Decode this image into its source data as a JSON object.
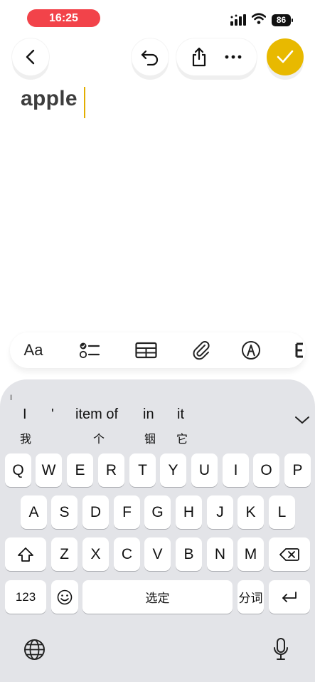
{
  "status_bar": {
    "time": "16:25",
    "battery": "86"
  },
  "note": {
    "text": "apple"
  },
  "format_toolbar": {
    "text_style_label": "Aa"
  },
  "candidates": {
    "small_label": "I",
    "top": [
      "I",
      "'",
      "item of",
      "in",
      "it"
    ],
    "bottom": [
      "我",
      "个",
      "铟",
      "它"
    ]
  },
  "keyboard": {
    "row1": [
      "Q",
      "W",
      "E",
      "R",
      "T",
      "Y",
      "U",
      "I",
      "O",
      "P"
    ],
    "row2": [
      "A",
      "S",
      "D",
      "F",
      "G",
      "H",
      "J",
      "K",
      "L"
    ],
    "row3": [
      "Z",
      "X",
      "C",
      "V",
      "B",
      "N",
      "M"
    ],
    "numbers_label": "123",
    "space_label": "选定",
    "segment_label": "分词"
  },
  "colors": {
    "accent": "#e8b900",
    "time_pill": "#f2434a",
    "keyboard_bg": "#e3e4e8"
  }
}
